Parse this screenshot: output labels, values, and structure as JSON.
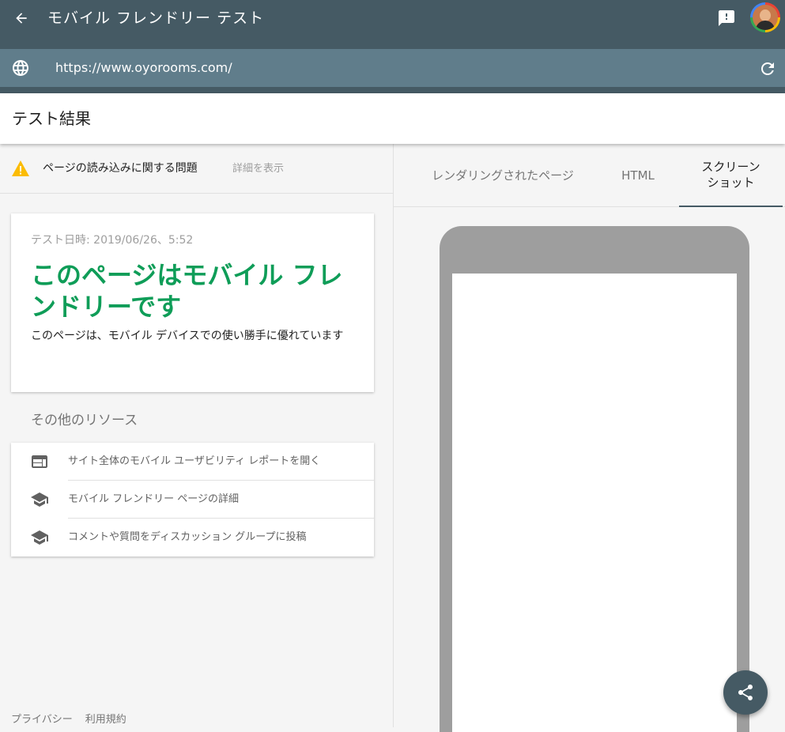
{
  "header": {
    "title": "モバイル フレンドリー テスト",
    "back_icon": "arrow-back-icon",
    "feedback_icon": "feedback-icon",
    "avatar_icon": "avatar"
  },
  "urlbar": {
    "url": "https://www.oyorooms.com/",
    "globe_icon": "globe-icon",
    "refresh_icon": "refresh-icon"
  },
  "result": {
    "heading": "テスト結果"
  },
  "warning": {
    "text": "ページの読み込みに関する問題",
    "link": "詳細を表示",
    "color": "#fbbc05"
  },
  "summary": {
    "date": "テスト日時: 2019/06/26、5:52",
    "verdict": "このページはモバイル フレンドリーです",
    "description": "このページは、モバイル デバイスでの使い勝手に優れています",
    "verdict_color": "#0f9d58"
  },
  "resources": {
    "title": "その他のリソース",
    "items": [
      {
        "label": "サイト全体のモバイル ユーザビリティ レポートを開く",
        "icon": "web-icon"
      },
      {
        "label": "モバイル フレンドリー ページの詳細",
        "icon": "school-icon"
      },
      {
        "label": "コメントや質問をディスカッション グループに投稿",
        "icon": "school-icon"
      }
    ]
  },
  "footer": {
    "privacy": "プライバシー",
    "terms": "利用規約"
  },
  "tabs": [
    {
      "label": "レンダリングされたページ",
      "active": false
    },
    {
      "label": "HTML",
      "active": false
    },
    {
      "label": "スクリーン ショット",
      "active": true
    }
  ],
  "fab": {
    "icon": "share-icon"
  },
  "colors": {
    "topbar": "#455a64",
    "urlbar": "#607d8b"
  }
}
